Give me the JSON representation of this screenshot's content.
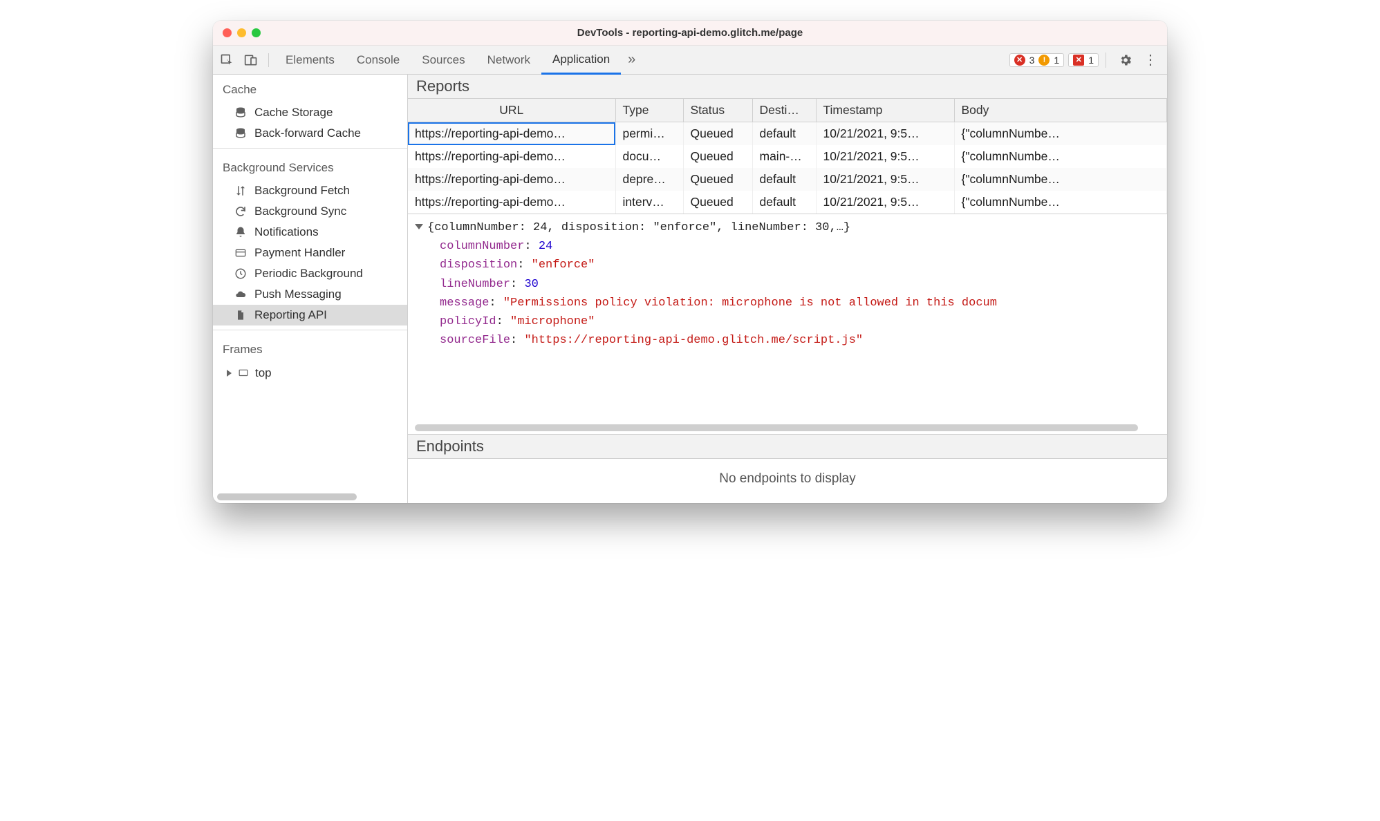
{
  "window": {
    "title": "DevTools - reporting-api-demo.glitch.me/page"
  },
  "toolbar": {
    "tabs": [
      "Elements",
      "Console",
      "Sources",
      "Network",
      "Application"
    ],
    "active": "Application",
    "errors": "3",
    "warnings": "1",
    "cross": "1"
  },
  "sidebar": {
    "sections": [
      {
        "title": "Cache",
        "items": [
          {
            "label": "Cache Storage",
            "icon": "database-icon"
          },
          {
            "label": "Back-forward Cache",
            "icon": "database-icon"
          }
        ]
      },
      {
        "title": "Background Services",
        "items": [
          {
            "label": "Background Fetch",
            "icon": "swap-icon"
          },
          {
            "label": "Background Sync",
            "icon": "sync-icon"
          },
          {
            "label": "Notifications",
            "icon": "bell-icon"
          },
          {
            "label": "Payment Handler",
            "icon": "card-icon"
          },
          {
            "label": "Periodic Background",
            "icon": "clock-icon"
          },
          {
            "label": "Push Messaging",
            "icon": "cloud-icon"
          },
          {
            "label": "Reporting API",
            "icon": "file-icon",
            "selected": true
          }
        ]
      },
      {
        "title": "Frames",
        "items": [
          {
            "label": "top",
            "icon": "frame-icon",
            "expander": true
          }
        ]
      }
    ]
  },
  "reports": {
    "heading": "Reports",
    "columns": [
      "URL",
      "Type",
      "Status",
      "Desti…",
      "Timestamp",
      "Body"
    ],
    "rows": [
      {
        "url": "https://reporting-api-demo…",
        "type": "permi…",
        "status": "Queued",
        "dest": "default",
        "ts": "10/21/2021, 9:5…",
        "body": "{\"columnNumbe…",
        "selected": true
      },
      {
        "url": "https://reporting-api-demo…",
        "type": "docu…",
        "status": "Queued",
        "dest": "main-…",
        "ts": "10/21/2021, 9:5…",
        "body": "{\"columnNumbe…"
      },
      {
        "url": "https://reporting-api-demo…",
        "type": "depre…",
        "status": "Queued",
        "dest": "default",
        "ts": "10/21/2021, 9:5…",
        "body": "{\"columnNumbe…"
      },
      {
        "url": "https://reporting-api-demo…",
        "type": "interv…",
        "status": "Queued",
        "dest": "default",
        "ts": "10/21/2021, 9:5…",
        "body": "{\"columnNumbe…"
      }
    ]
  },
  "json": {
    "summary": "{columnNumber: 24, disposition: \"enforce\", lineNumber: 30,…}",
    "entries": [
      {
        "k": "columnNumber",
        "v": "24",
        "t": "num"
      },
      {
        "k": "disposition",
        "v": "\"enforce\"",
        "t": "str"
      },
      {
        "k": "lineNumber",
        "v": "30",
        "t": "num"
      },
      {
        "k": "message",
        "v": "\"Permissions policy violation: microphone is not allowed in this docum",
        "t": "str"
      },
      {
        "k": "policyId",
        "v": "\"microphone\"",
        "t": "str"
      },
      {
        "k": "sourceFile",
        "v": "\"https://reporting-api-demo.glitch.me/script.js\"",
        "t": "str"
      }
    ]
  },
  "endpoints": {
    "heading": "Endpoints",
    "empty": "No endpoints to display"
  }
}
